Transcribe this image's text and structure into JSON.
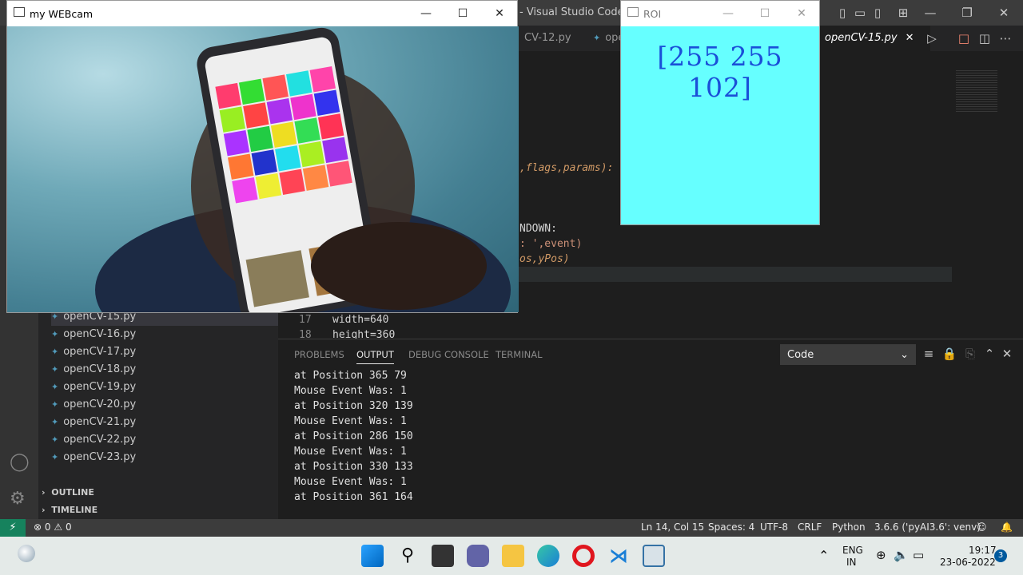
{
  "vscode": {
    "title": "- Visual Studio Code",
    "tabs": [
      {
        "label": "CV-12.py"
      },
      {
        "label": "ope"
      },
      {
        "label": "openCV-15.py"
      }
    ],
    "files": [
      "openCV-15.py",
      "openCV-16.py",
      "openCV-17.py",
      "openCV-18.py",
      "openCV-19.py",
      "openCV-20.py",
      "openCV-21.py",
      "openCV-22.py",
      "openCV-23.py"
    ],
    "sections": {
      "outline": "OUTLINE",
      "timeline": "TIMELINE"
    },
    "code": {
      "l1": ",flags,params):",
      "l2": "NDOWN:",
      "l3": ": ',event)",
      "l4": "os,yPos)",
      "line17_no": "17",
      "line17": "width=640",
      "line18_no": "18",
      "line18": "height=360"
    },
    "panel": {
      "tabs": [
        "PROBLEMS",
        "OUTPUT",
        "DEBUG CONSOLE",
        "TERMINAL"
      ],
      "select_value": "Code",
      "output": [
        "at Position 365 79",
        "Mouse Event Was:  1",
        "at Position 320 139",
        "Mouse Event Was:  1",
        "at Position 286 150",
        "Mouse Event Was:  1",
        "at Position 330 133",
        "Mouse Event Was:  1",
        "at Position 361 164"
      ]
    },
    "status": {
      "errors": "0",
      "warnings": "0",
      "position": "Ln 14, Col 15",
      "spaces": "Spaces: 4",
      "encoding": "UTF-8",
      "eol": "CRLF",
      "language": "Python",
      "interpreter": "3.6.6 ('pyAI3.6': venv)"
    }
  },
  "webcam": {
    "title": "my WEBcam"
  },
  "roi": {
    "title": "ROI",
    "value": "[255 255 102]",
    "color": "#66ffff"
  },
  "taskbar": {
    "lang1": "ENG",
    "lang2": "IN",
    "time": "19:17",
    "date": "23-06-2022",
    "badge": "3"
  }
}
